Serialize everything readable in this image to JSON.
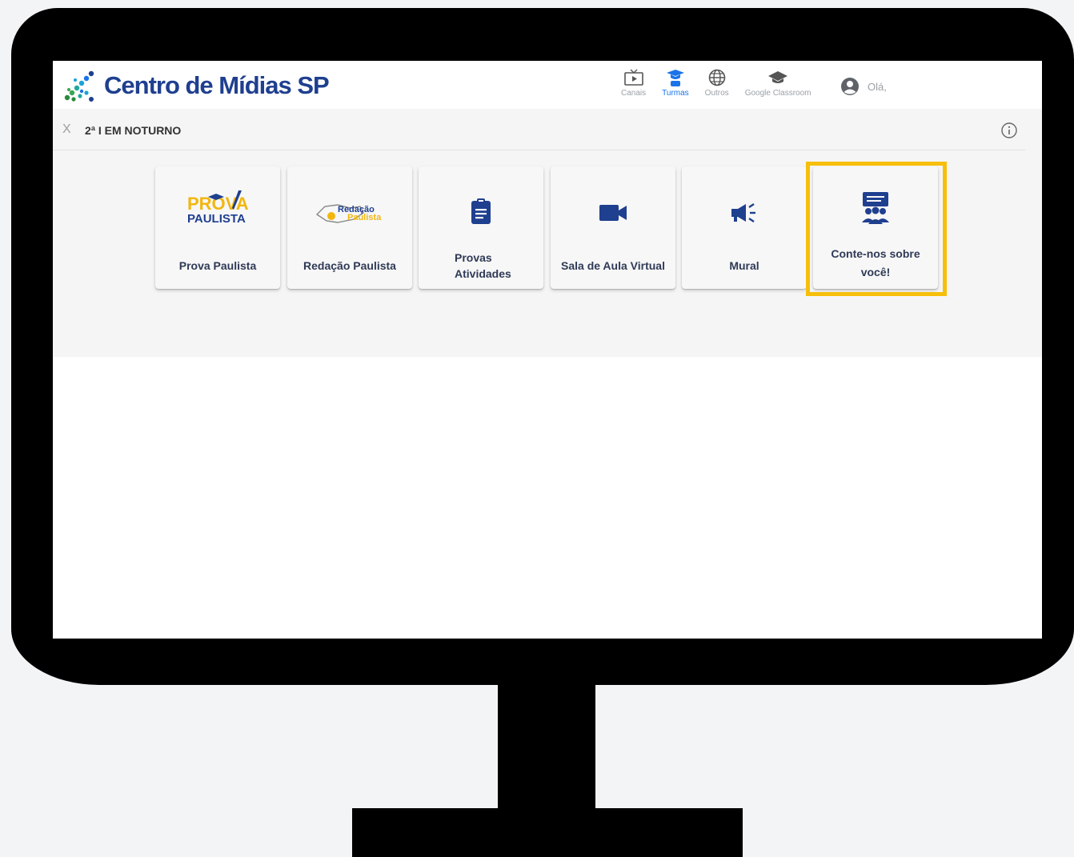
{
  "app": {
    "title": "Centro de Mídias SP",
    "brand_color": "#1f3f8f"
  },
  "nav": {
    "items": [
      {
        "label": "Canais",
        "icon": "tv-play-icon"
      },
      {
        "label": "Turmas",
        "icon": "student-icon",
        "active": true
      },
      {
        "label": "Outros",
        "icon": "globe-icon"
      },
      {
        "label": "Google Classroom",
        "icon": "graduation-cap-icon"
      }
    ],
    "user_greeting": "Olá,"
  },
  "subheader": {
    "close": "X",
    "class_name": "2ª I EM NOTURNO"
  },
  "cards": [
    {
      "label": "Prova Paulista",
      "icon": "prova-paulista-logo",
      "logo_text_top": "PROVA",
      "logo_text_bottom": "PAULISTA"
    },
    {
      "label": "Redação Paulista",
      "icon": "redacao-paulista-logo",
      "logo_text_top": "Redação",
      "logo_text_bottom": "Paulista"
    },
    {
      "label_line1": "Provas",
      "label_line2": "Atividades",
      "icon": "clipboard-icon"
    },
    {
      "label": "Sala de Aula Virtual",
      "icon": "video-camera-icon"
    },
    {
      "label": "Mural",
      "icon": "megaphone-icon"
    },
    {
      "label_line1": "Conte-nos sobre",
      "label_line2": "você!",
      "icon": "presentation-group-icon"
    }
  ],
  "colors": {
    "highlight": "#f7bf0a",
    "active_nav": "#1a73e8",
    "icon_blue": "#1f3f8f"
  }
}
